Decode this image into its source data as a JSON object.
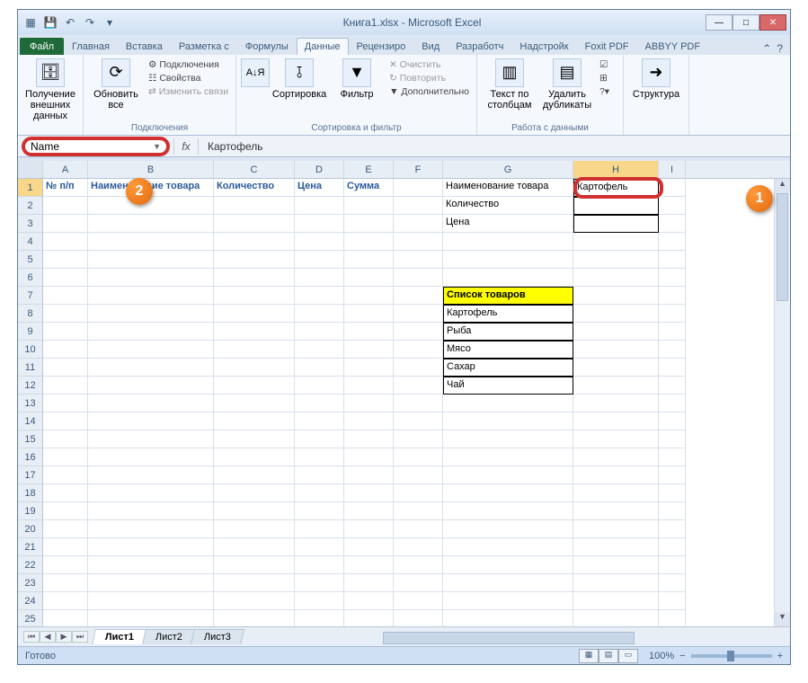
{
  "window": {
    "title": "Книга1.xlsx - Microsoft Excel"
  },
  "qat": {
    "save": "💾",
    "undo": "↶",
    "redo": "↷",
    "new": "▦",
    "print": "⎙"
  },
  "tabs": {
    "file": "Файл",
    "items": [
      "Главная",
      "Вставка",
      "Разметка с",
      "Формулы",
      "Данные",
      "Рецензиро",
      "Вид",
      "Разработч",
      "Надстройк",
      "Foxit PDF",
      "ABBYY PDF"
    ],
    "active_index": 4
  },
  "ribbon": {
    "group1": {
      "big": "Получение\nвнешних данных"
    },
    "group2": {
      "big": "Обновить\nвсе",
      "items": [
        "Подключения",
        "Свойства",
        "Изменить связи"
      ],
      "label": "Подключения"
    },
    "group3": {
      "sort": "Сортировка",
      "filter": "Фильтр",
      "clear": "Очистить",
      "reapply": "Повторить",
      "advanced": "Дополнительно",
      "label": "Сортировка и фильтр"
    },
    "group4": {
      "text": "Текст по\nстолбцам",
      "dups": "Удалить\nдубликаты",
      "label": "Работа с данными"
    },
    "group5": {
      "big": "Структура"
    }
  },
  "formula_bar": {
    "name_box": "Name",
    "fx": "fx",
    "value": "Картофель"
  },
  "columns": [
    "A",
    "B",
    "C",
    "D",
    "E",
    "F",
    "G",
    "H",
    "I"
  ],
  "row_count": 27,
  "table_headers": {
    "A1": "№ п/п",
    "B1": "Наименование товара",
    "C1": "Количество",
    "D1": "Цена",
    "E1": "Сумма"
  },
  "side_labels": {
    "G1": "Наименование товара",
    "G2": "Количество",
    "G3": "Цена",
    "H1": "Картофель"
  },
  "product_list": {
    "header": "Список товаров",
    "items": [
      "Картофель",
      "Рыба",
      "Мясо",
      "Сахар",
      "Чай"
    ]
  },
  "sheets": {
    "items": [
      "Лист1",
      "Лист2",
      "Лист3"
    ],
    "active": 0
  },
  "status": {
    "ready": "Готово",
    "zoom": "100%"
  },
  "callouts": {
    "one": "1",
    "two": "2"
  }
}
